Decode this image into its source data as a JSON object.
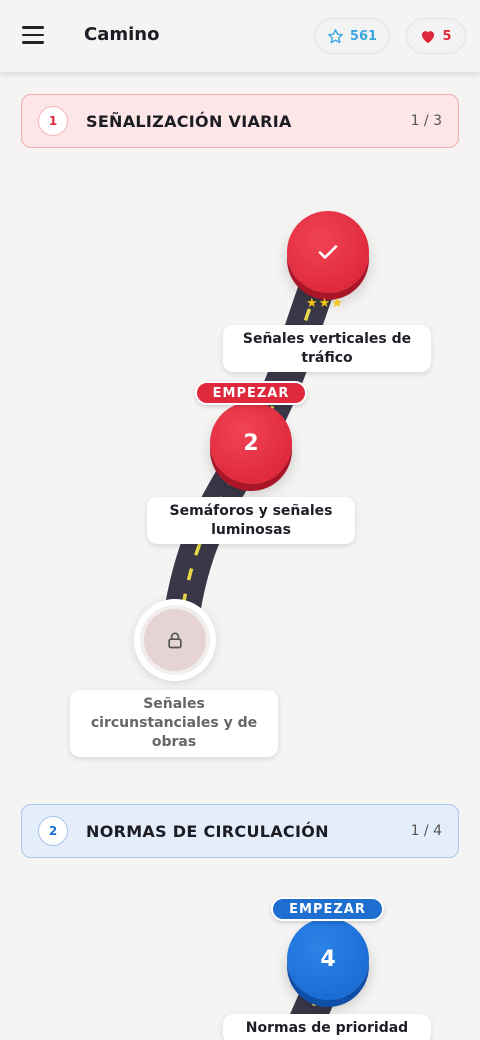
{
  "header": {
    "title": "Camino",
    "stars_count": "561",
    "hearts_count": "5"
  },
  "sections": [
    {
      "number": "1",
      "title": "SEÑALIZACIÓN VIARIA",
      "progress": "1 / 3",
      "color": "#e0283d",
      "lessons": [
        {
          "label": "Señales verticales de tráfico",
          "state": "completed",
          "stars": "★★★",
          "icon": "check-icon"
        },
        {
          "label": "Semáforos y señales luminosas",
          "state": "current",
          "number": "2",
          "badge": "EMPEZAR"
        },
        {
          "label": "Señales circunstanciales y de obras",
          "state": "locked",
          "icon": "lock-icon"
        }
      ]
    },
    {
      "number": "2",
      "title": "NORMAS DE CIRCULACIÓN",
      "progress": "1 / 4",
      "color": "#1f6fd0",
      "lessons": [
        {
          "label": "Normas de prioridad en",
          "state": "current",
          "number": "4",
          "badge": "EMPEZAR"
        }
      ]
    }
  ],
  "icons": {
    "menu": "hamburger-menu-icon",
    "stars": "star-outline-icon",
    "hearts": "heart-icon"
  }
}
